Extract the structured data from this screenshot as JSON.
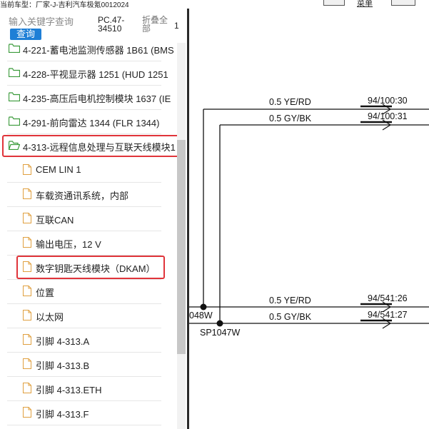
{
  "header": {
    "vehicle_text": "当前车型：厂家-J-吉利汽车极氪0012024",
    "mid_button_label": "菜单"
  },
  "search": {
    "placeholder": "输入关键字查询",
    "query_button": "查询",
    "pc_label": "PC.47-\n34510",
    "collapse_label": "折叠全\n部",
    "collapse_extra": "1"
  },
  "tree": {
    "folders": [
      {
        "label": "4-221-蓄电池监测传感器 1B61 (BMS"
      },
      {
        "label": "4-228-平视显示器 1251 (HUD 1251"
      },
      {
        "label": "4-235-高压后电机控制模块 1637 (IE"
      },
      {
        "label": "4-291-前向雷达 1344 (FLR 1344)"
      },
      {
        "label": "4-313-远程信息处理与互联天线模块1",
        "highlighted": true
      }
    ],
    "children": [
      {
        "label": "CEM LIN 1"
      },
      {
        "label": "车载资通讯系统，内部"
      },
      {
        "label": "互联CAN"
      },
      {
        "label": "输出电压，12 V"
      },
      {
        "label": "数字钥匙天线模块（DKAM）",
        "highlighted": true
      },
      {
        "label": "位置"
      },
      {
        "label": "以太网"
      },
      {
        "label": "引脚 4-313.A"
      },
      {
        "label": "引脚 4-313.B"
      },
      {
        "label": "引脚 4-313.ETH"
      },
      {
        "label": "引脚 4-313.F"
      }
    ]
  },
  "diagram": {
    "wires": [
      {
        "spec": "0.5 YE/RD",
        "ref": "94/100:30"
      },
      {
        "spec": "0.5 GY/BK",
        "ref": "94/100:31"
      },
      {
        "spec": "0.5 YE/RD",
        "ref": "94/541:26"
      },
      {
        "spec": "0.5 GY/BK",
        "ref": "94/541:27"
      }
    ],
    "splice_left": "048W",
    "splice_right": "SP1047W"
  },
  "colors": {
    "accent": "#1e7fd6",
    "highlight": "#e0343a",
    "folder_icon": "#3a9a3a",
    "doc_icon": "#e0a040"
  }
}
